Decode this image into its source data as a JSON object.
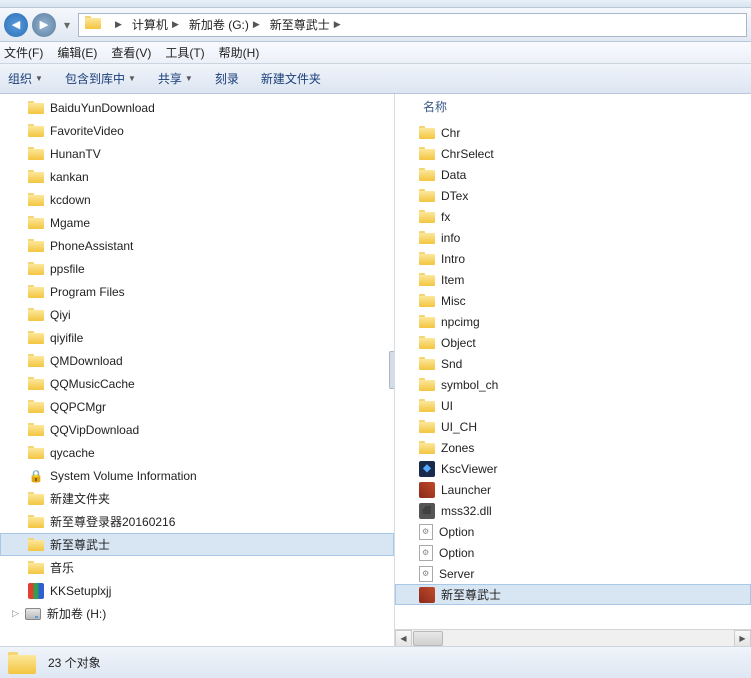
{
  "breadcrumb": [
    "计算机",
    "新加卷 (G:)",
    "新至尊武士"
  ],
  "menus": [
    "文件(F)",
    "编辑(E)",
    "查看(V)",
    "工具(T)",
    "帮助(H)"
  ],
  "toolbar": {
    "organize": "组织",
    "include": "包含到库中",
    "share": "共享",
    "burn": "刻录",
    "newfolder": "新建文件夹"
  },
  "column_header": "名称",
  "tree": [
    {
      "name": "BaiduYunDownload",
      "icon": "folder"
    },
    {
      "name": "FavoriteVideo",
      "icon": "folder"
    },
    {
      "name": "HunanTV",
      "icon": "folder"
    },
    {
      "name": "kankan",
      "icon": "folder"
    },
    {
      "name": "kcdown",
      "icon": "folder"
    },
    {
      "name": "Mgame",
      "icon": "folder"
    },
    {
      "name": "PhoneAssistant",
      "icon": "folder"
    },
    {
      "name": "ppsfile",
      "icon": "folder"
    },
    {
      "name": "Program Files",
      "icon": "folder"
    },
    {
      "name": "Qiyi",
      "icon": "folder"
    },
    {
      "name": "qiyifile",
      "icon": "folder"
    },
    {
      "name": "QMDownload",
      "icon": "folder"
    },
    {
      "name": "QQMusicCache",
      "icon": "folder"
    },
    {
      "name": "QQPCMgr",
      "icon": "folder"
    },
    {
      "name": "QQVipDownload",
      "icon": "folder"
    },
    {
      "name": "qycache",
      "icon": "folder"
    },
    {
      "name": "System Volume Information",
      "icon": "lock"
    },
    {
      "name": "新建文件夹",
      "icon": "folder"
    },
    {
      "name": "新至尊登录器20160216",
      "icon": "folder"
    },
    {
      "name": "新至尊武士",
      "icon": "folder",
      "selected": true
    },
    {
      "name": "音乐",
      "icon": "folder"
    },
    {
      "name": "KKSetuplxjj",
      "icon": "colorapp"
    }
  ],
  "extradrive": "新加卷 (H:)",
  "files": [
    {
      "name": "Chr",
      "icon": "folder"
    },
    {
      "name": "ChrSelect",
      "icon": "folder"
    },
    {
      "name": "Data",
      "icon": "folder"
    },
    {
      "name": "DTex",
      "icon": "folder"
    },
    {
      "name": "fx",
      "icon": "folder"
    },
    {
      "name": "info",
      "icon": "folder"
    },
    {
      "name": "Intro",
      "icon": "folder"
    },
    {
      "name": "Item",
      "icon": "folder"
    },
    {
      "name": "Misc",
      "icon": "folder"
    },
    {
      "name": "npcimg",
      "icon": "folder"
    },
    {
      "name": "Object",
      "icon": "folder"
    },
    {
      "name": "Snd",
      "icon": "folder"
    },
    {
      "name": "symbol_ch",
      "icon": "folder"
    },
    {
      "name": "UI",
      "icon": "folder"
    },
    {
      "name": "UI_CH",
      "icon": "folder"
    },
    {
      "name": "Zones",
      "icon": "folder"
    },
    {
      "name": "KscViewer",
      "icon": "app1"
    },
    {
      "name": "Launcher",
      "icon": "app2"
    },
    {
      "name": "mss32.dll",
      "icon": "app3"
    },
    {
      "name": "Option",
      "icon": "cfg"
    },
    {
      "name": "Option",
      "icon": "cfg"
    },
    {
      "name": "Server",
      "icon": "cfg"
    },
    {
      "name": "新至尊武士",
      "icon": "app2",
      "selected": true
    }
  ],
  "status": "23 个对象"
}
